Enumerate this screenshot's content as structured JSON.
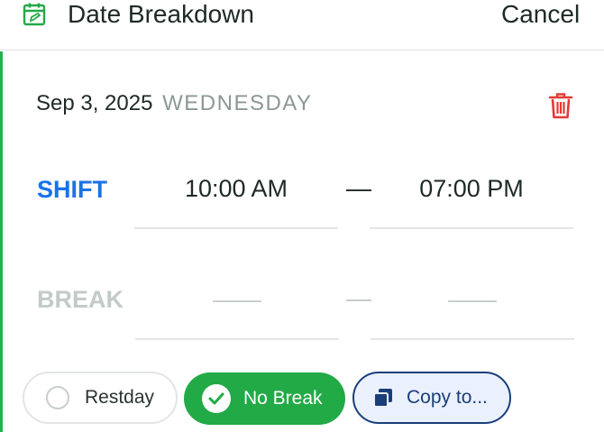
{
  "header": {
    "title": "Date Breakdown",
    "cancel_label": "Cancel"
  },
  "date": {
    "date_text": "Sep 3, 2025",
    "day_of_week": "WEDNESDAY"
  },
  "shift": {
    "label": "SHIFT",
    "start": "10:00 AM",
    "separator": "—",
    "end": "07:00 PM"
  },
  "break": {
    "label": "BREAK",
    "start": "——",
    "separator": "—",
    "end": "——"
  },
  "actions": {
    "restday_label": "Restday",
    "nobreak_label": "No Break",
    "copy_label": "Copy to..."
  },
  "colors": {
    "accent_green": "#22aa47",
    "shift_blue": "#1a73e8",
    "delete_red": "#e53935",
    "copy_navy": "#1b3e7a"
  },
  "icons": [
    "calendar-edit-icon",
    "trash-icon",
    "radio-icon",
    "check-circle-icon",
    "copy-icon"
  ]
}
